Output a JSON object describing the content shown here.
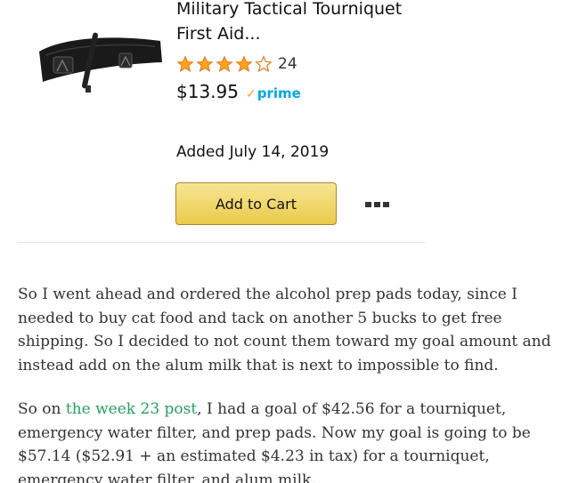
{
  "product": {
    "title": "Military Tactical Tourniquet First Aid...",
    "rating": 4,
    "max_rating": 5,
    "review_count": "24",
    "price": "$13.95",
    "prime_label": "prime",
    "added_date": "Added July 14, 2019",
    "add_to_cart_label": "Add to Cart",
    "more_options_icon": "more-dots-icon",
    "image_icon": "tourniquet-strap-image"
  },
  "article": {
    "paragraph1": "So I went ahead and ordered the alcohol prep pads today, since I needed to buy cat food and tack on another 5 bucks to get free shipping. So I decided to not count them toward my goal amount and instead add on the alum milk that is next to impossible to find.",
    "paragraph2_before": "So on ",
    "paragraph2_link": "the week 23 post",
    "paragraph2_after": ", I had a goal of $42.56 for a tourniquet, emergency water filter, and prep pads. Now my goal is going to be $57.14 ($52.91 + an estimated $4.23 in tax) for a tourniquet, emergency water filter, and alum milk."
  },
  "colors": {
    "star": "#ffa41c",
    "star_outline": "#de7921",
    "prime": "#00a8e1",
    "button_top": "#f7e594",
    "button_bottom": "#eacb4a",
    "link": "#26a05f"
  }
}
